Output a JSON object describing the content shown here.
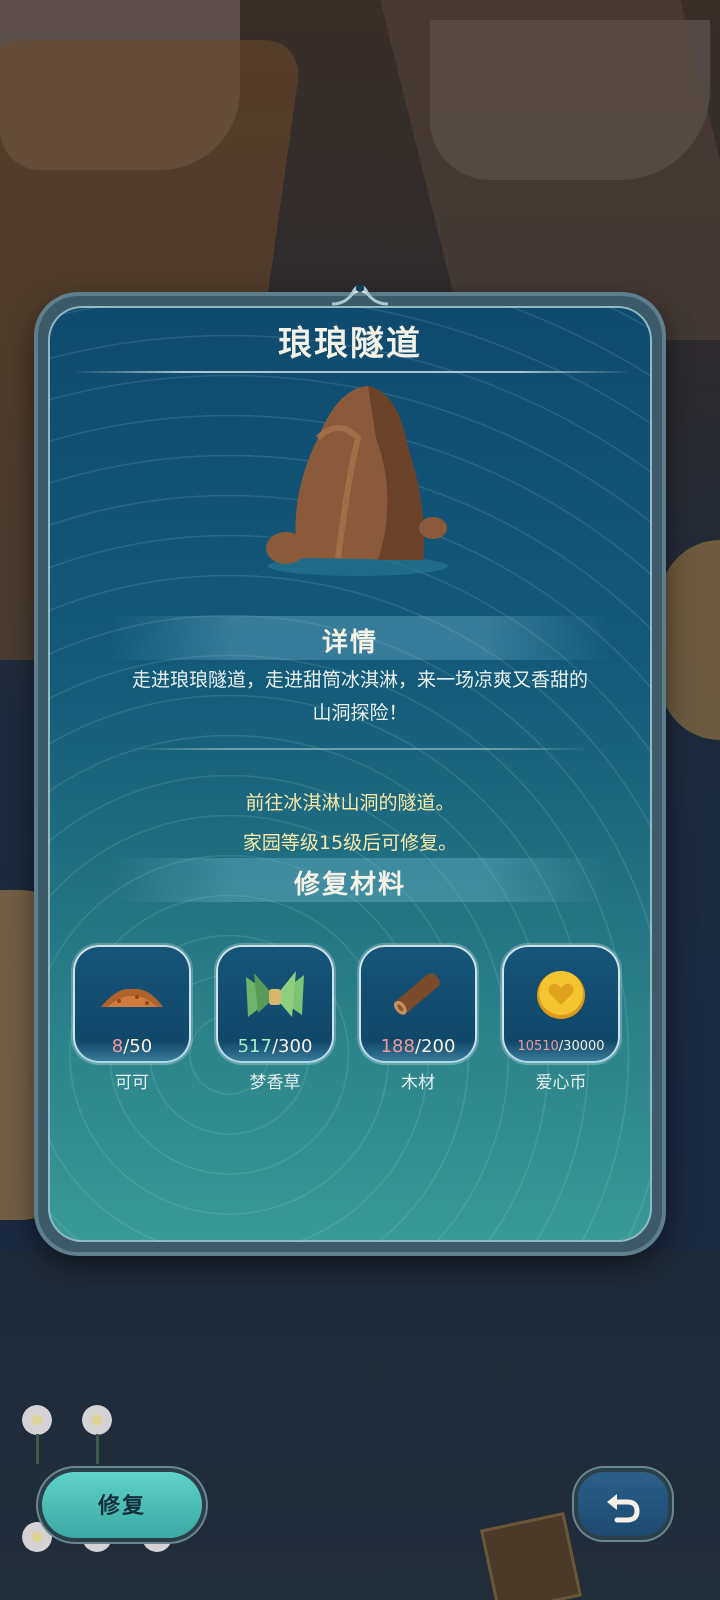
{
  "panel": {
    "title": "琅琅隧道",
    "image_icon": "rock-icon"
  },
  "details": {
    "heading": "详情",
    "description_line1": "走进琅琅隧道，走进甜筒冰淇淋，来一场凉爽又香甜的",
    "description_line2": "山洞探险！",
    "info_line1": "前往冰淇淋山洞的隧道。",
    "info_line2": "家园等级15级后可修复。"
  },
  "materials": {
    "heading": "修复材料",
    "items": [
      {
        "name": "可可",
        "have": "8",
        "need": "/50",
        "icon": "cocoa-icon",
        "sufficient": false
      },
      {
        "name": "梦香草",
        "have": "517",
        "need": "/300",
        "icon": "grass-bundle-icon",
        "sufficient": true
      },
      {
        "name": "木材",
        "have": "188",
        "need": "/200",
        "icon": "wood-log-icon",
        "sufficient": false
      },
      {
        "name": "爱心币",
        "have": "10510",
        "need": "/30000",
        "icon": "heart-coin-icon",
        "sufficient": false
      }
    ]
  },
  "actions": {
    "repair_label": "修复",
    "back_icon": "back-arrow-icon"
  },
  "colors": {
    "insufficient": "#f29a9a",
    "sufficient": "#9ff0c8",
    "info_text": "#f8e9a8"
  }
}
